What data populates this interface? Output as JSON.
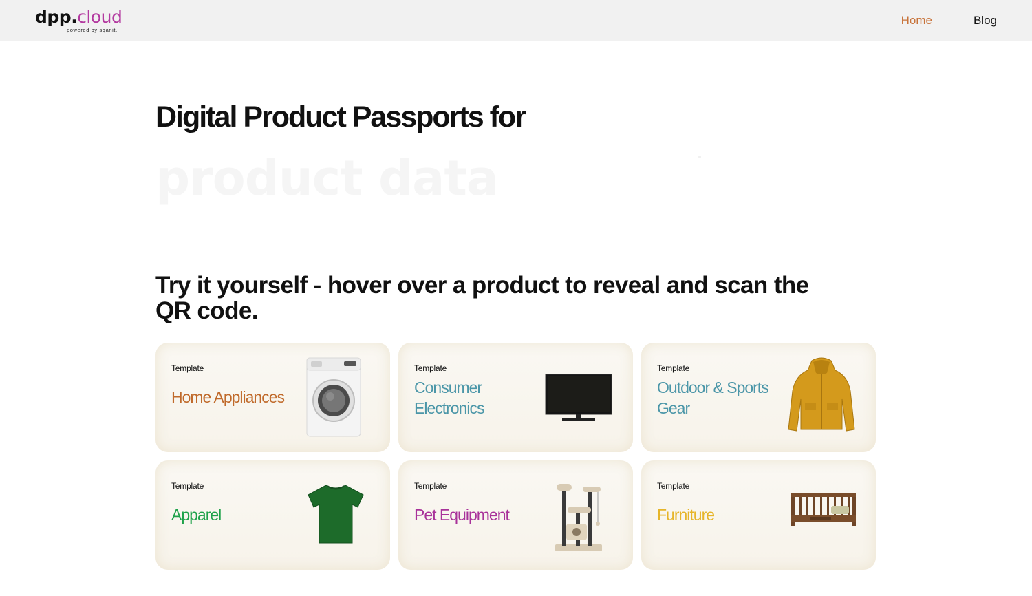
{
  "header": {
    "logo_main": "dpp",
    "logo_dot": ".",
    "logo_accent": "cloud",
    "logo_sub": "powered by sqanit.",
    "nav": [
      {
        "label": "Home",
        "active": true
      },
      {
        "label": "Blog",
        "active": false
      }
    ]
  },
  "hero": {
    "title": "Digital Product Passports for",
    "typed_text": "product data"
  },
  "subtitle": "Try it yourself - hover over a product to reveal and scan the QR code.",
  "cards": [
    {
      "tag": "Template",
      "title": "Home Appliances",
      "color": "#c06a2b",
      "icon": "washing-machine-icon"
    },
    {
      "tag": "Template",
      "title": "Consumer Electronics",
      "color": "#4b96a8",
      "icon": "tv-icon"
    },
    {
      "tag": "Template",
      "title": "Outdoor & Sports Gear",
      "color": "#4b96a8",
      "icon": "jacket-icon"
    },
    {
      "tag": "Template",
      "title": "Apparel",
      "color": "#1ea24a",
      "icon": "tshirt-icon"
    },
    {
      "tag": "Template",
      "title": "Pet Equipment",
      "color": "#a8329a",
      "icon": "cat-tree-icon"
    },
    {
      "tag": "Template",
      "title": "Furniture",
      "color": "#e6b52a",
      "icon": "crib-bed-icon"
    }
  ]
}
